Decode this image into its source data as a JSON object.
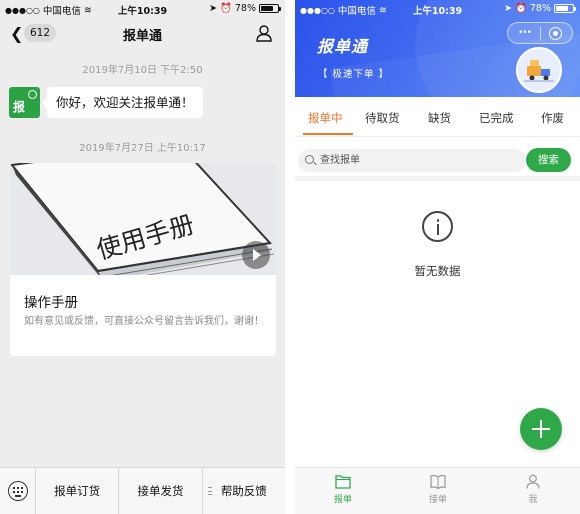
{
  "status": {
    "carrier": "中国电信",
    "time": "上午10:39",
    "battery": "78%",
    "battery_level": 0.78
  },
  "chat": {
    "unread_count": "612",
    "title": "报单通",
    "timestamp_1": "2019年7月10日 下午2:50",
    "greeting": "你好，欢迎关注报单通！",
    "avatar_text": "报",
    "timestamp_2": "2019年7月27日 上午10:17",
    "article": {
      "cover_text": "使用手册",
      "title": "操作手册",
      "description": "如有意见或反馈，可直接公众号留言告诉我们，谢谢！"
    },
    "menu": [
      "报单订货",
      "接单发货",
      "帮助反馈"
    ]
  },
  "app": {
    "banner_title": "报单通",
    "banner_tag": "【 极速下单 】",
    "capsule_more": "•••",
    "tabs": [
      "报单中",
      "待取货",
      "缺货",
      "已完成",
      "作废"
    ],
    "active_tab": 0,
    "search_placeholder": "查找报单",
    "search_button": "搜索",
    "empty_text": "暂无数据",
    "tabbar": [
      "报单",
      "接单",
      "我"
    ],
    "active_tabbar": 0
  },
  "colors": {
    "wechat_green": "#2ba345",
    "accent_green": "#2fa84a",
    "tab_orange": "#f0762e",
    "banner_blue": "#3f6af0"
  }
}
